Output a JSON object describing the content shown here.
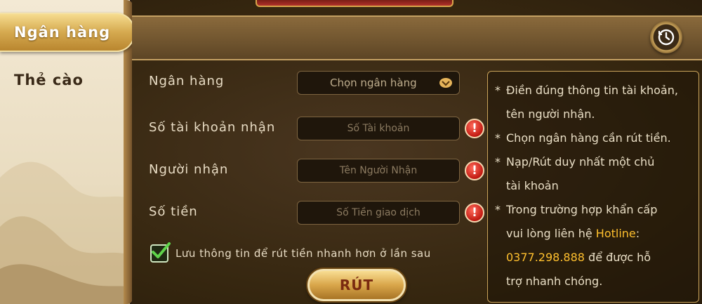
{
  "sidebar": {
    "tabs": [
      {
        "label": "Ngân hàng"
      },
      {
        "label": "Thẻ cào"
      }
    ]
  },
  "form": {
    "bank": {
      "label": "Ngân hàng",
      "value": "Chọn ngân hàng"
    },
    "account": {
      "label": "Số tài khoản nhận",
      "placeholder": "Số Tài khoản"
    },
    "recipient": {
      "label": "Người nhận",
      "placeholder": "Tên Người Nhận"
    },
    "amount": {
      "label": "Số tiền",
      "placeholder": "Số Tiền giao dịch"
    },
    "save_info": {
      "label": "Lưu thông tin để rút tiền nhanh hơn ở lần sau",
      "checked": true
    },
    "submit_label": "RÚT",
    "warning_glyph": "!"
  },
  "notes": {
    "bullet": "*",
    "line1a": "Điền đúng thông tin tài khoản,",
    "line1b": "tên người nhận.",
    "line2": "Chọn ngân hàng cần rút tiền.",
    "line3a": "Nạp/Rút duy nhất một chủ",
    "line3b": "tài khoản",
    "line4a": "Trong trường hợp khẩn cấp",
    "line4b_prefix": "vui lòng liên hệ ",
    "hotline_label": "Hotline",
    "line4b_suffix": ":",
    "hotline_number": "0377.298.888",
    "line4c_suffix": " để được hỗ",
    "line4d": "trợ nhanh chóng."
  },
  "icons": {
    "history": "history-clock-icon",
    "select": "chevron-down-icon",
    "warning": "warning-icon",
    "check": "checkmark-icon"
  },
  "colors": {
    "accent_gold": "#d5a94f",
    "hotline": "#ffc02e",
    "warning_red": "#c11a12"
  }
}
